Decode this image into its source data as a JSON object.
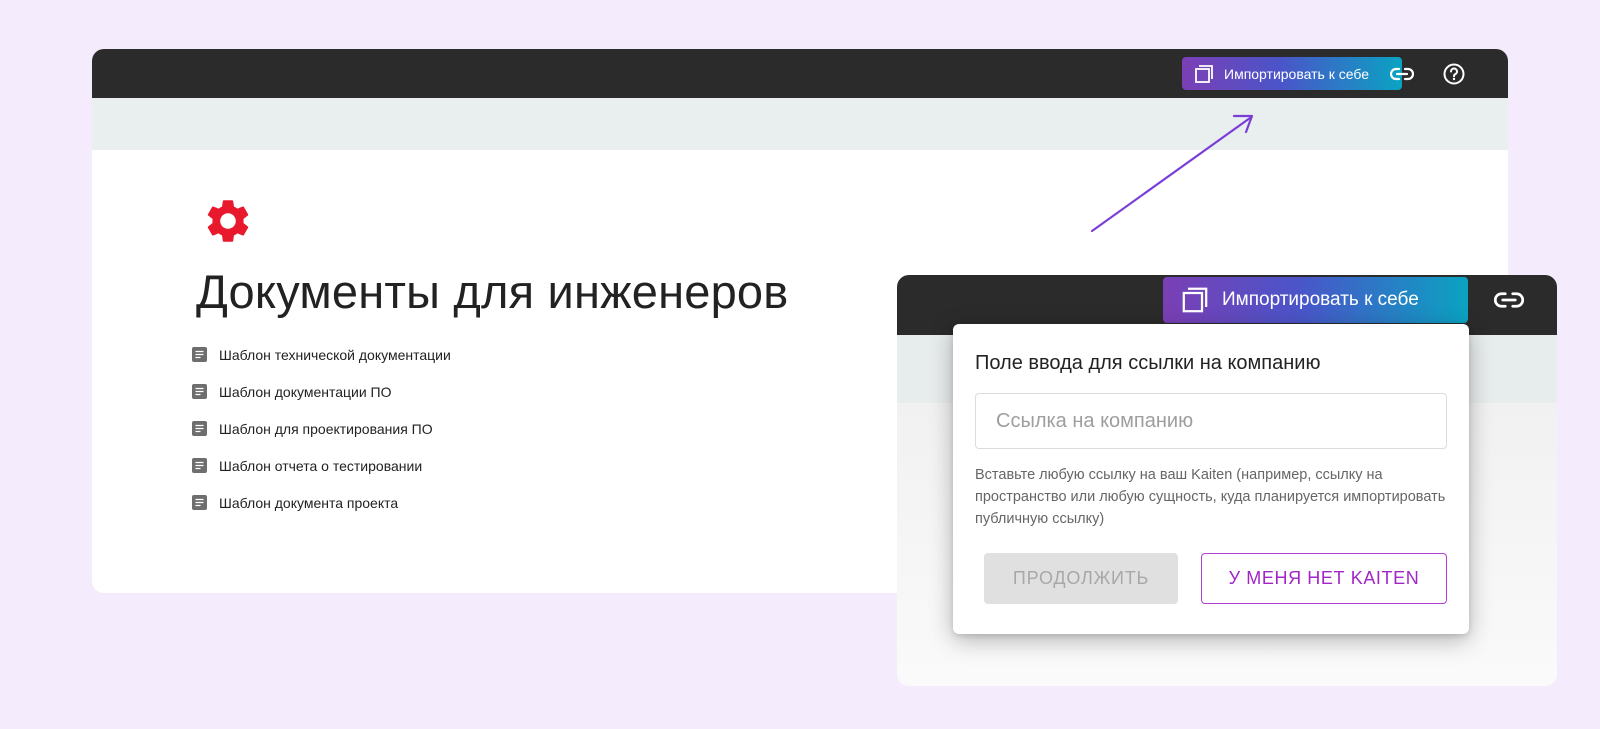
{
  "window1": {
    "import_label": "Импортировать к себе",
    "title": "Документы для инженеров",
    "documents": [
      "Шаблон технической документации",
      "Шаблон документации ПО",
      "Шаблон для проектирования ПО",
      "Шаблон отчета о тестировании",
      "Шаблон документа проекта"
    ]
  },
  "window2": {
    "import_label": "Импортировать к себе"
  },
  "popup": {
    "title": "Поле ввода для ссылки на компанию",
    "input_value": "",
    "input_placeholder": "Ссылка на компанию",
    "hint": "Вставьте любую ссылку на ваш Kaiten (например, ссылку на пространство или любую сущность, куда планируется импортировать публичную ссылку)",
    "continue_label": "ПРОДОЛЖИТЬ",
    "no_kaiten_label": "У МЕНЯ НЕТ KAITEN"
  },
  "icons": {
    "import": "copy-icon",
    "link": "link-icon",
    "help": "help-circle-icon",
    "gear": "gear-icon",
    "document": "document-icon",
    "annotation": "arrow"
  },
  "colors": {
    "background": "#f4ebfd",
    "topbar": "#2b2b2b",
    "gear": "#e8192c",
    "accent": "#a225c8",
    "arrow": "#7b3fd9"
  }
}
